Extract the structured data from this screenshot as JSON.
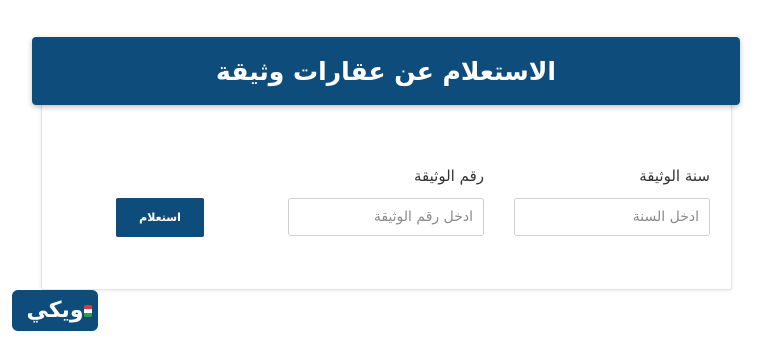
{
  "header": {
    "title": "الاستعلام عن عقارات وثيقة"
  },
  "form": {
    "year": {
      "label": "سنة الوثيقة",
      "placeholder": "ادخل السنة",
      "value": ""
    },
    "number": {
      "label": "رقم الوثيقة",
      "placeholder": "ادخل رقم الوثيقة",
      "value": ""
    },
    "submit_label": "استعلام"
  },
  "logo": {
    "text": "ويكي"
  },
  "colors": {
    "primary": "#0e4d7b",
    "border": "#cfcfcf",
    "placeholder": "#8a8a8a"
  }
}
